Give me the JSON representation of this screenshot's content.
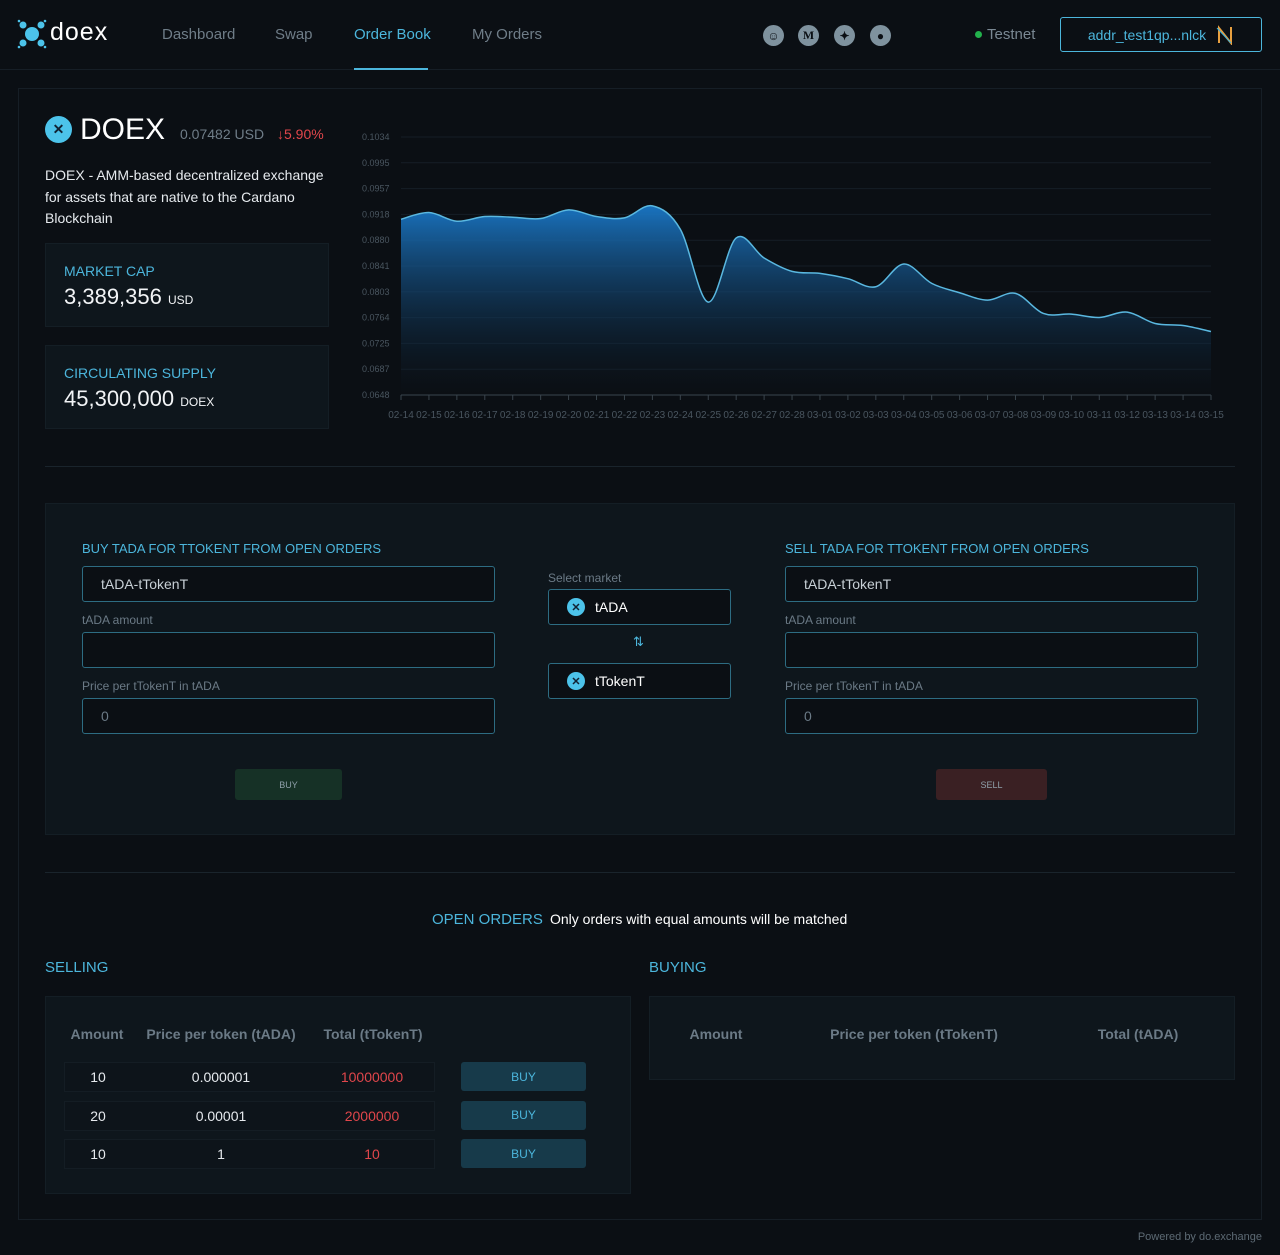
{
  "header": {
    "logo": "doex",
    "nav": [
      {
        "label": "Dashboard"
      },
      {
        "label": "Swap"
      },
      {
        "label": "Order Book",
        "active": true
      },
      {
        "label": "My Orders"
      }
    ],
    "social_icons": [
      "discord-icon",
      "medium-icon",
      "twitter-icon",
      "reddit-icon"
    ],
    "network": "Testnet",
    "network_color": "#22b14c",
    "wallet": "addr_test1qp...nlck"
  },
  "token": {
    "name": "DOEX",
    "price": "0.07482 USD",
    "change": "↓5.90%",
    "change_color": "#e0464b",
    "description": "DOEX - AMM-based decentralized exchange for assets that are native to the Cardano Blockchain",
    "market_cap_label": "MARKET CAP",
    "market_cap": "3,389,356",
    "market_cap_unit": "USD",
    "supply_label": "CIRCULATING SUPPLY",
    "supply": "45,300,000",
    "supply_unit": "DOEX"
  },
  "chart_data": {
    "type": "area",
    "ylim": [
      0.0648,
      0.1034
    ],
    "yticks": [
      "0.1034",
      "0.0995",
      "0.0957",
      "0.0918",
      "0.0880",
      "0.0841",
      "0.0803",
      "0.0764",
      "0.0725",
      "0.0687",
      "0.0648"
    ],
    "x": [
      "02-14",
      "02-15",
      "02-16",
      "02-17",
      "02-18",
      "02-19",
      "02-20",
      "02-21",
      "02-22",
      "02-23",
      "02-24",
      "02-25",
      "02-26",
      "02-27",
      "02-28",
      "03-01",
      "03-02",
      "03-03",
      "03-04",
      "03-05",
      "03-06",
      "03-07",
      "03-08",
      "03-09",
      "03-10",
      "03-11",
      "03-12",
      "03-13",
      "03-14",
      "03-15"
    ],
    "values": [
      0.0911,
      0.0921,
      0.0908,
      0.0915,
      0.0914,
      0.0912,
      0.0925,
      0.0915,
      0.0913,
      0.0931,
      0.0896,
      0.0787,
      0.0883,
      0.0853,
      0.0833,
      0.083,
      0.0822,
      0.081,
      0.0844,
      0.0815,
      0.0801,
      0.079,
      0.08,
      0.077,
      0.0769,
      0.0764,
      0.0772,
      0.0755,
      0.0752,
      0.0743
    ],
    "grid": true,
    "line_color": "#5ab8e0",
    "fill_color": "#1a78c8"
  },
  "trade": {
    "buy": {
      "title": "BUY TADA FOR TTOKENT FROM OPEN ORDERS",
      "pair": "tADA-tTokenT",
      "amount_label": "tADA amount",
      "amount": "",
      "price_label": "Price per tTokenT in tADA",
      "price_placeholder": "0",
      "button": "BUY"
    },
    "market": {
      "label": "Select market",
      "from": "tADA",
      "to": "tTokenT"
    },
    "sell": {
      "title": "SELL TADA FOR TTOKENT FROM OPEN ORDERS",
      "pair": "tADA-tTokenT",
      "amount_label": "tADA amount",
      "amount": "",
      "price_label": "Price per tTokenT in tADA",
      "price_placeholder": "0",
      "button": "SELL"
    }
  },
  "orders": {
    "title": "OPEN ORDERS",
    "note": "Only orders with equal amounts will be matched",
    "selling": {
      "title": "SELLING",
      "headers": [
        "Amount",
        "Price per token (tADA)",
        "Total (tTokenT)"
      ],
      "rows": [
        {
          "amount": "10",
          "price": "0.000001",
          "total": "10000000",
          "action": "BUY"
        },
        {
          "amount": "20",
          "price": "0.00001",
          "total": "2000000",
          "action": "BUY"
        },
        {
          "amount": "10",
          "price": "1",
          "total": "10",
          "action": "BUY"
        }
      ]
    },
    "buying": {
      "title": "BUYING",
      "headers": [
        "Amount",
        "Price per token (tTokenT)",
        "Total (tADA)"
      ],
      "rows": []
    }
  },
  "footer": "Powered by do.exchange"
}
